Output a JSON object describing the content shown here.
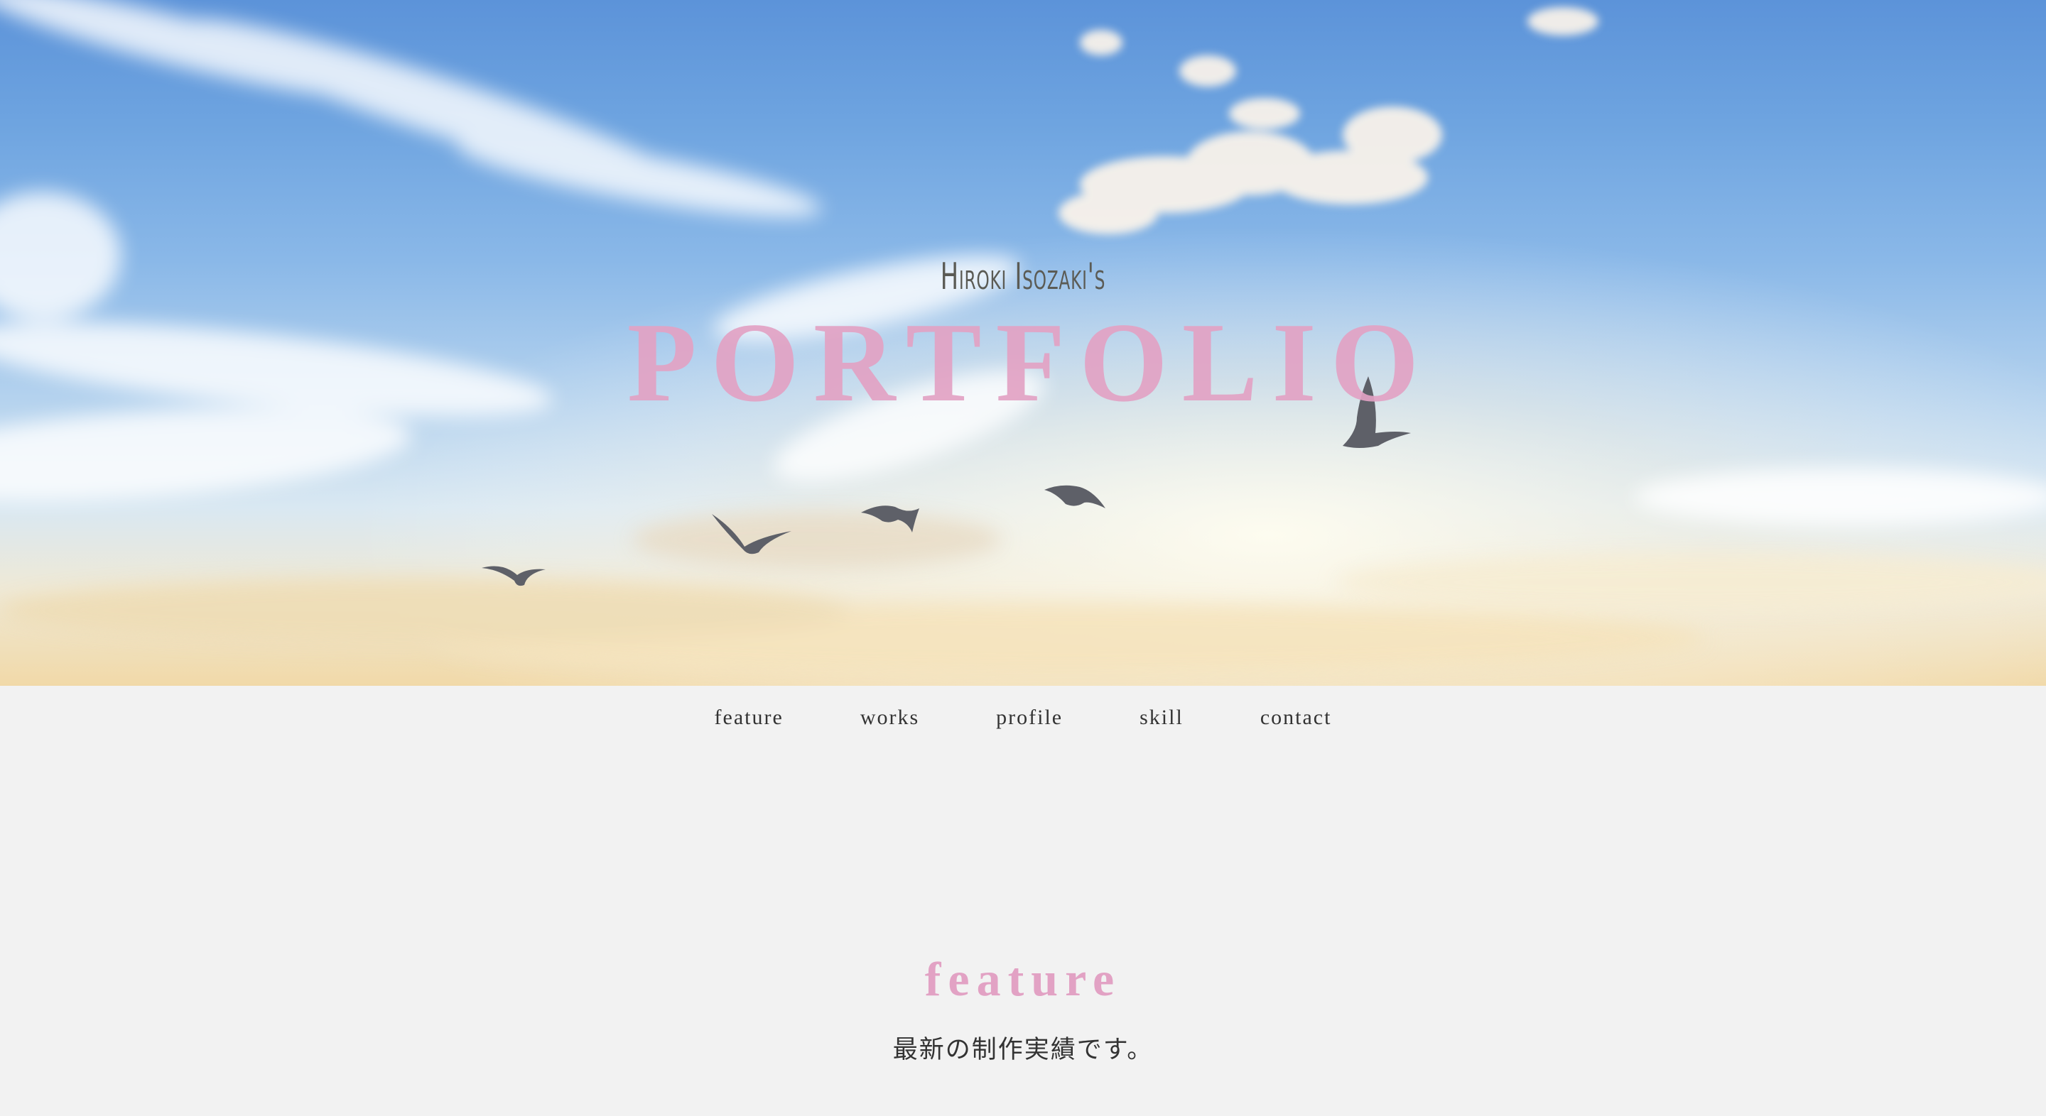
{
  "hero": {
    "subtitle": "Hiroki Isozaki's",
    "title": "PORTFOLIO"
  },
  "nav": {
    "items": [
      {
        "label": "feature"
      },
      {
        "label": "works"
      },
      {
        "label": "profile"
      },
      {
        "label": "skill"
      },
      {
        "label": "contact"
      }
    ]
  },
  "feature": {
    "title": "feature",
    "description": "最新の制作実績です。"
  },
  "colors": {
    "accent_pink": "#e2a2c4",
    "page_background": "#f2f2f2",
    "text": "#333333"
  }
}
